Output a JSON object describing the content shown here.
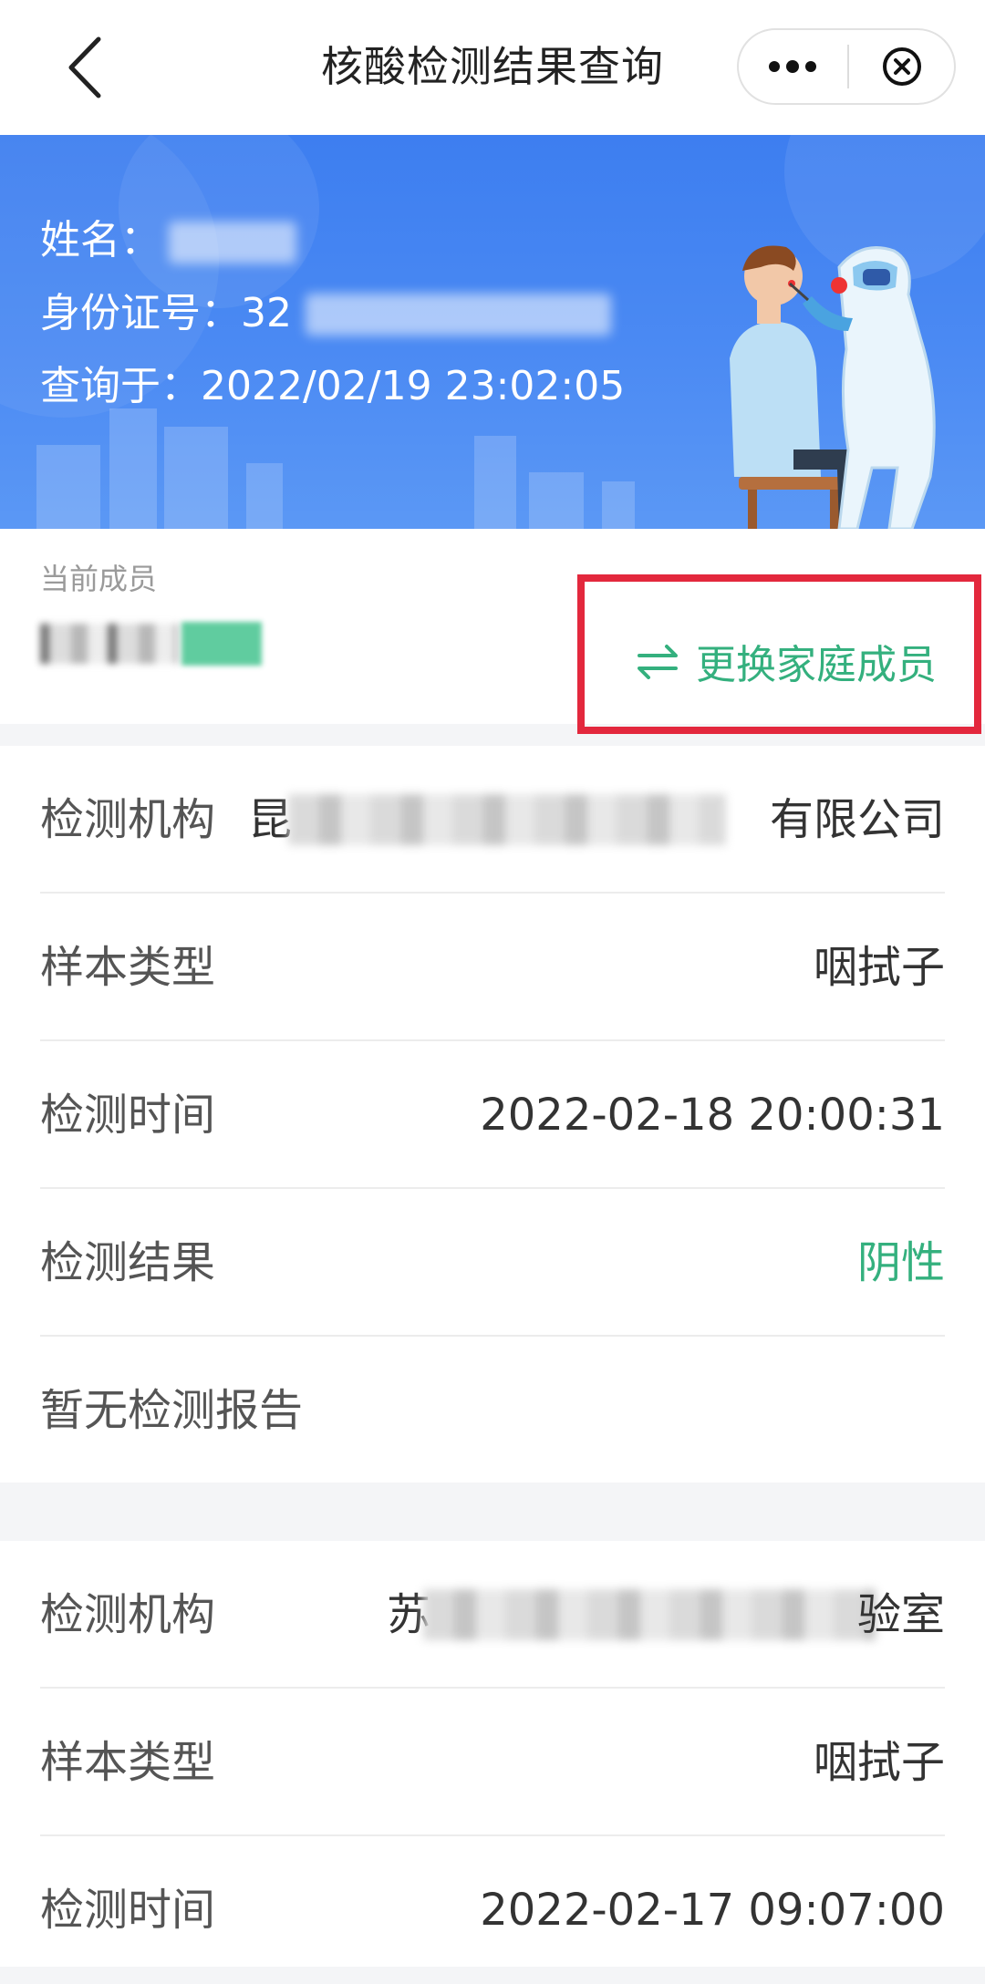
{
  "navbar": {
    "title": "核酸检测结果查询"
  },
  "banner": {
    "name_label": "姓名：",
    "name_value": "⁠",
    "id_label": "身份证号：",
    "id_prefix": "32",
    "query_time_label": "查询于：",
    "query_time": "2022/02/19 23:02:05"
  },
  "member": {
    "current_label": "当前成员",
    "switch_label": "更换家庭成员"
  },
  "colors": {
    "accent_green": "#34b07e",
    "banner_blue": "#4b8af3",
    "highlight_red": "#e3283d"
  },
  "records": [
    {
      "org_label": "检测机构",
      "org_visible_start": "昆",
      "org_visible_end": "有限公司",
      "sample_label": "样本类型",
      "sample_value": "咽拭子",
      "time_label": "检测时间",
      "time_value": "2022-02-18 20:00:31",
      "result_label": "检测结果",
      "result_value": "阴性",
      "report_text": "暂无检测报告"
    },
    {
      "org_label": "检测机构",
      "org_visible_start": "苏",
      "org_visible_end": "验室",
      "sample_label": "样本类型",
      "sample_value": "咽拭子",
      "time_label": "检测时间",
      "time_value": "2022-02-17 09:07:00"
    }
  ]
}
